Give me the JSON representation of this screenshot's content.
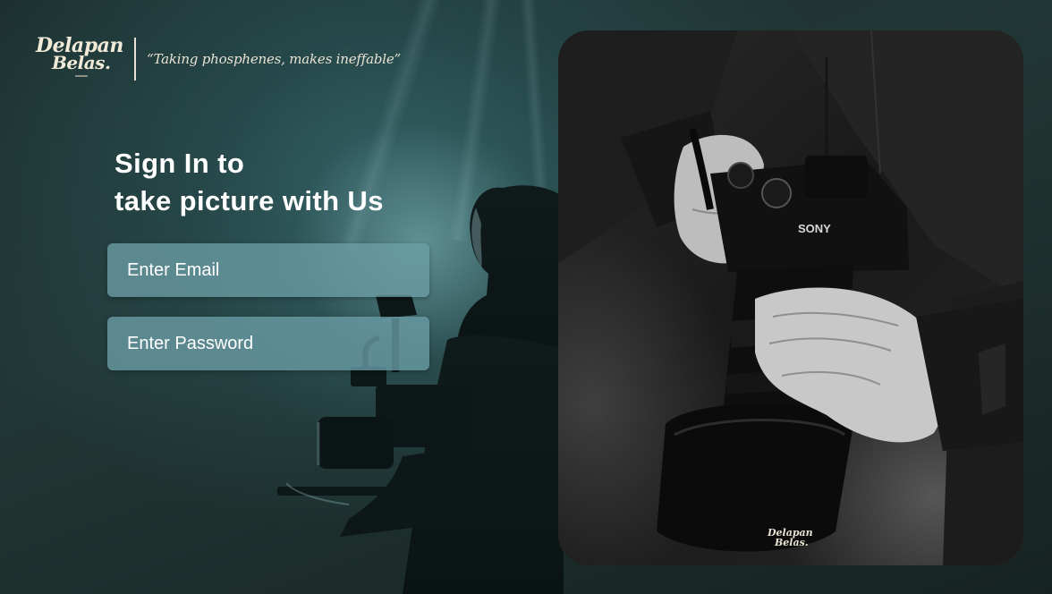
{
  "brand": {
    "logo_line1": "Delapan",
    "logo_line2": "Belas.",
    "tagline": "“Taking phosphenes, makes ineffable”"
  },
  "signin": {
    "heading_line1": "Sign In to",
    "heading_line2": "take picture with Us",
    "email_placeholder": "Enter Email",
    "password_placeholder": "Enter Password"
  },
  "photo": {
    "camera_brand": "SONY",
    "watermark_line1": "Delapan",
    "watermark_line2": "Belas."
  },
  "colors": {
    "background": "#1b2d2c",
    "input_fill": "#6c9ea6",
    "heading_text": "#ffffff",
    "brand_cream": "#f1ead7"
  }
}
